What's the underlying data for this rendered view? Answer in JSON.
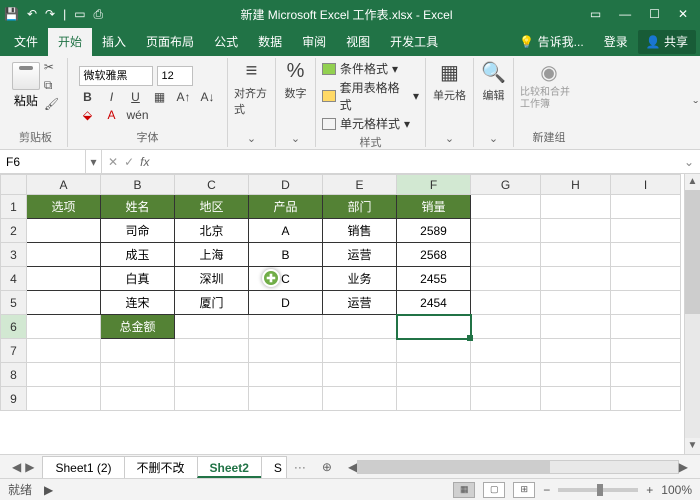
{
  "titlebar": {
    "title": "新建 Microsoft Excel 工作表.xlsx - Excel"
  },
  "menu": {
    "file": "文件",
    "home": "开始",
    "insert": "插入",
    "layout": "页面布局",
    "formula": "公式",
    "data": "数据",
    "review": "审阅",
    "view": "视图",
    "dev": "开发工具",
    "tell": "告诉我...",
    "login": "登录",
    "share": "共享"
  },
  "ribbon": {
    "paste": "粘贴",
    "clipboard": "剪贴板",
    "font_name": "微软雅黑",
    "font_size": "12",
    "font_group": "字体",
    "align": "对齐方式",
    "number": "数字",
    "cond_format": "条件格式",
    "table_format": "套用表格格式",
    "cell_style": "单元格样式",
    "styles": "样式",
    "cells": "单元格",
    "edit": "编辑",
    "compare": "比较和合并工作簿",
    "newgroup": "新建组"
  },
  "namebox": "F6",
  "cols": [
    "A",
    "B",
    "C",
    "D",
    "E",
    "F",
    "G",
    "H",
    "I"
  ],
  "rows": [
    "1",
    "2",
    "3",
    "4",
    "5",
    "6",
    "7",
    "8",
    "9"
  ],
  "headers": {
    "A": "选项",
    "B": "姓名",
    "C": "地区",
    "D": "产品",
    "E": "部门",
    "F": "销量"
  },
  "data_rows": [
    {
      "B": "司命",
      "C": "北京",
      "D": "A",
      "E": "销售",
      "F": "2589"
    },
    {
      "B": "成玉",
      "C": "上海",
      "D": "B",
      "E": "运营",
      "F": "2568"
    },
    {
      "B": "白真",
      "C": "深圳",
      "D": "C",
      "E": "业务",
      "F": "2455"
    },
    {
      "B": "连宋",
      "C": "厦门",
      "D": "D",
      "E": "运营",
      "F": "2454"
    }
  ],
  "total_label": "总金额",
  "sheets": {
    "s1": "Sheet1 (2)",
    "s2": "不删不改",
    "s3": "Sheet2",
    "s4": "S"
  },
  "status": {
    "ready": "就绪",
    "zoom": "100%"
  }
}
